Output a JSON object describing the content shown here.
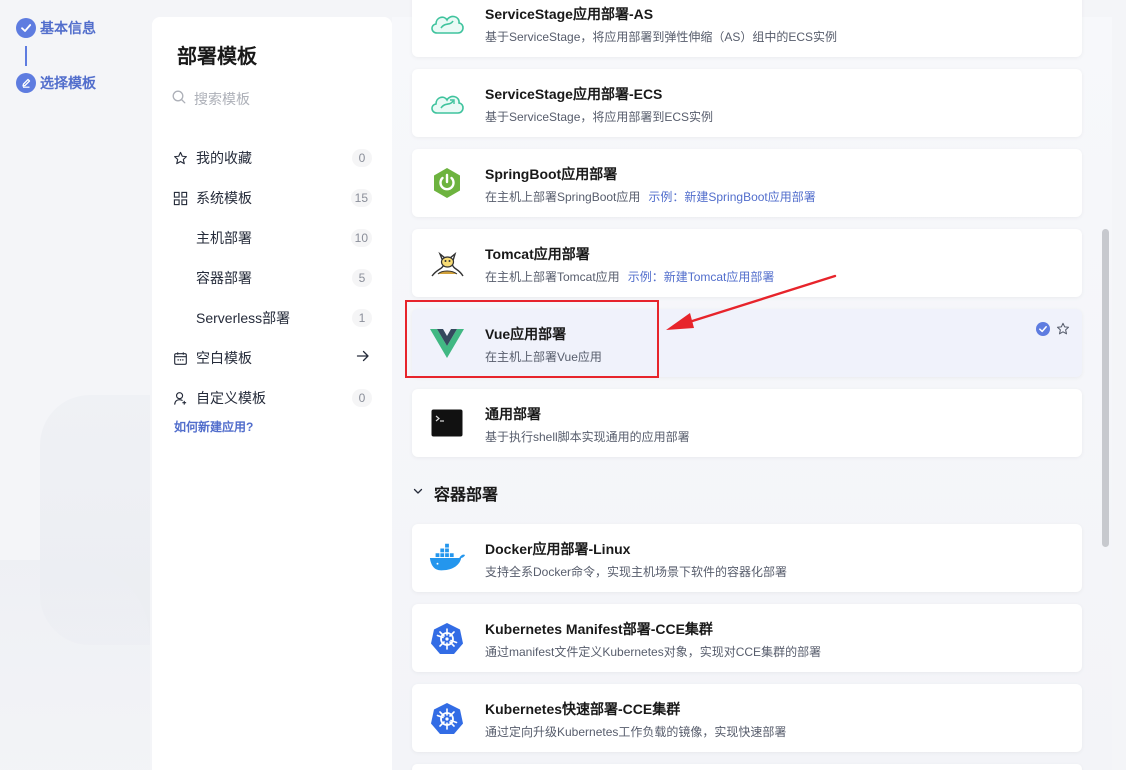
{
  "steps": [
    {
      "label": "基本信息"
    },
    {
      "label": "选择模板"
    }
  ],
  "panel": {
    "title": "部署模板",
    "search_placeholder": "搜索模板",
    "menu": [
      {
        "label": "我的收藏",
        "count": "0"
      },
      {
        "label": "系统模板",
        "count": "15"
      },
      {
        "label": "主机部署",
        "count": "10"
      },
      {
        "label": "容器部署",
        "count": "5"
      },
      {
        "label": "Serverless部署",
        "count": "1"
      },
      {
        "label": "空白模板"
      },
      {
        "label": "自定义模板",
        "count": "0"
      }
    ],
    "help_link": "如何新建应用?"
  },
  "cards": [
    {
      "title": "ServiceStage应用部署-AS",
      "desc": "基于ServiceStage，将应用部署到弹性伸缩（AS）组中的ECS实例",
      "icon": "servicestage-icon"
    },
    {
      "title": "ServiceStage应用部署-ECS",
      "desc": "基于ServiceStage，将应用部署到ECS实例",
      "icon": "servicestage-icon"
    },
    {
      "title": "SpringBoot应用部署",
      "desc": "在主机上部署SpringBoot应用",
      "example": "示例：新建SpringBoot应用部署",
      "icon": "springboot-icon"
    },
    {
      "title": "Tomcat应用部署",
      "desc": "在主机上部署Tomcat应用",
      "example": "示例：新建Tomcat应用部署",
      "icon": "tomcat-icon"
    },
    {
      "title": "Vue应用部署",
      "desc": "在主机上部署Vue应用",
      "icon": "vue-icon",
      "selected": true
    },
    {
      "title": "通用部署",
      "desc": "基于执行shell脚本实现通用的应用部署",
      "icon": "terminal-icon"
    },
    {
      "title": "Docker应用部署-Linux",
      "desc": "支持全系Docker命令，实现主机场景下软件的容器化部署",
      "icon": "docker-icon"
    },
    {
      "title": "Kubernetes Manifest部署-CCE集群",
      "desc": "通过manifest文件定义Kubernetes对象，实现对CCE集群的部署",
      "icon": "kubernetes-icon"
    },
    {
      "title": "Kubernetes快速部署-CCE集群",
      "desc": "通过定向升级Kubernetes工作负载的镜像，实现快速部署",
      "icon": "kubernetes-icon"
    }
  ],
  "group_container": {
    "label": "容器部署"
  },
  "colors": {
    "accent": "#5e7ce0",
    "link": "#526ecc",
    "highlight": "#e7242b"
  }
}
